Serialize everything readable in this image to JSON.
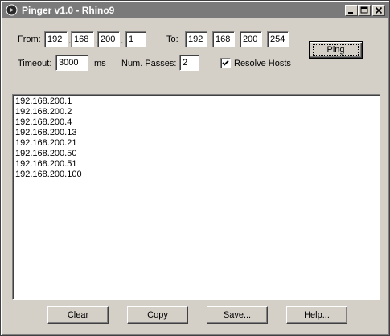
{
  "window": {
    "title": "Pinger v1.0 - Rhino9"
  },
  "from": {
    "label": "From:",
    "octets": [
      "192",
      "168",
      "200",
      "1"
    ],
    "separator": "."
  },
  "to": {
    "label": "To:",
    "octets": [
      "192",
      "168",
      "200",
      "254"
    ]
  },
  "timeout": {
    "label": "Timeout:",
    "value": "3000",
    "unit": "ms"
  },
  "passes": {
    "label": "Num. Passes:",
    "value": "2"
  },
  "resolve_hosts": {
    "label": "Resolve Hosts",
    "checked": true
  },
  "buttons": {
    "ping": "Ping",
    "clear": "Clear",
    "copy": "Copy",
    "save": "Save...",
    "help": "Help..."
  },
  "results": [
    "192.168.200.1",
    "192.168.200.2",
    "192.168.200.4",
    "192.168.200.13",
    "192.168.200.21",
    "192.168.200.50",
    "192.168.200.51",
    "192.168.200.100"
  ]
}
